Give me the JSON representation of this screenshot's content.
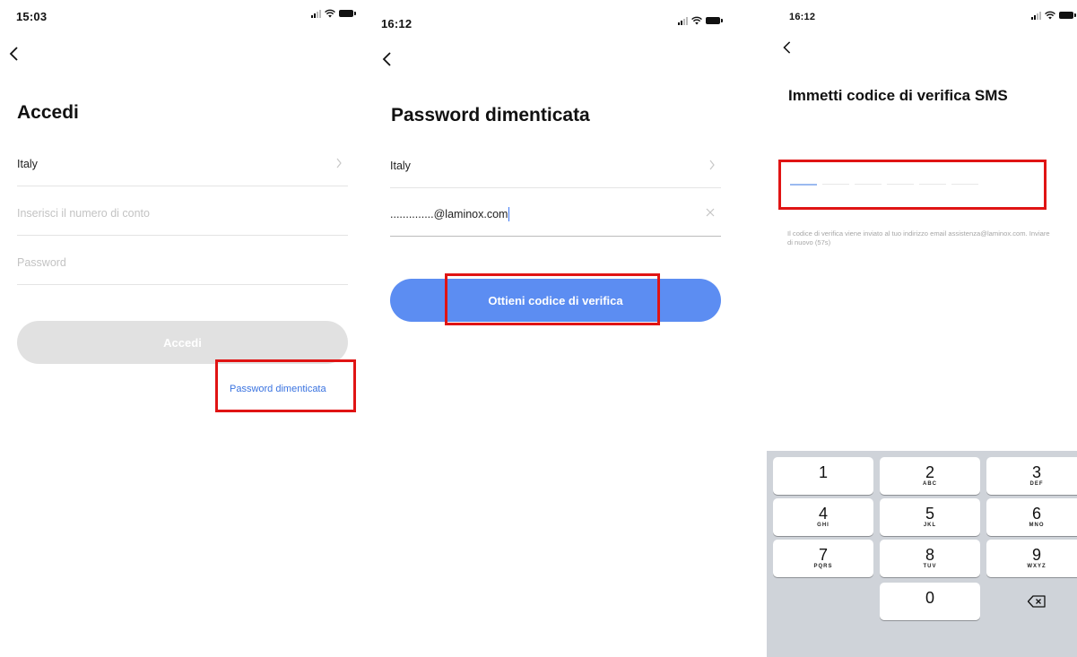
{
  "screens": {
    "login": {
      "status_time": "15:03",
      "title": "Accedi",
      "country_value": "Italy",
      "account_placeholder": "Inserisci il numero di conto",
      "password_placeholder": "Password",
      "login_button_label": "Accedi",
      "forgot_password_link": "Password dimenticata"
    },
    "forgot_password": {
      "status_time": "16:12",
      "title": "Password dimenticata",
      "country_value": "Italy",
      "email_value": "..............@laminox.com",
      "get_code_button_label": "Ottieni codice di verifica"
    },
    "sms_verification": {
      "status_time": "16:12",
      "title": "Immetti codice di verifica SMS",
      "code_slot_count": 6,
      "note_text": "Il codice di verifica viene inviato al tuo indirizzo email assistenza@laminox.com. Inviare di nuovo (57s)",
      "keypad": [
        {
          "digit": "1",
          "letters": ""
        },
        {
          "digit": "2",
          "letters": "ABC"
        },
        {
          "digit": "3",
          "letters": "DEF"
        },
        {
          "digit": "4",
          "letters": "GHI"
        },
        {
          "digit": "5",
          "letters": "JKL"
        },
        {
          "digit": "6",
          "letters": "MNO"
        },
        {
          "digit": "7",
          "letters": "PQRS"
        },
        {
          "digit": "8",
          "letters": "TUV"
        },
        {
          "digit": "9",
          "letters": "WXYZ"
        },
        {
          "digit": "0",
          "letters": ""
        }
      ]
    }
  },
  "colors": {
    "highlight_red": "#e01414",
    "primary_blue": "#5c8df2",
    "link_blue": "#3a73e0",
    "disabled_grey": "#e1e1e1",
    "keyboard_bg": "#cfd3d9"
  },
  "icons": [
    "back-chevron-icon",
    "chevron-right-icon",
    "clear-x-icon",
    "signal-icon",
    "wifi-icon",
    "battery-icon",
    "backspace-icon"
  ]
}
